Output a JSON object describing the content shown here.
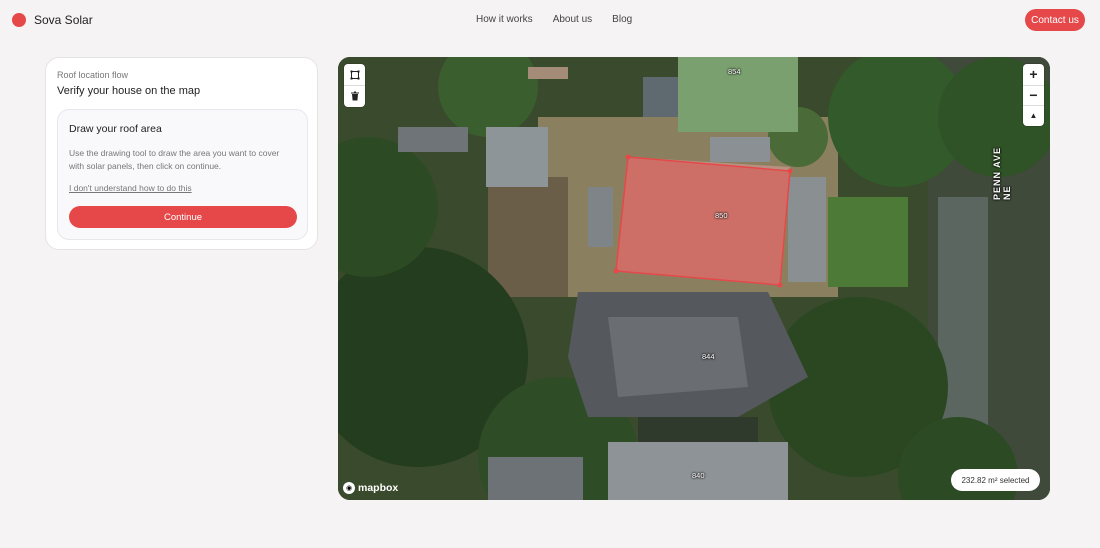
{
  "header": {
    "brand": "Sova Solar",
    "nav": [
      "How it works",
      "About us",
      "Blog"
    ],
    "contact_label": "Contact us"
  },
  "panel": {
    "flow_label": "Roof location flow",
    "title": "Verify your house on the map",
    "card": {
      "title": "Draw your roof area",
      "description": "Use the drawing tool to draw the area you want to cover with solar panels, then click on continue.",
      "help_link": "I don't understand how to do this",
      "continue_label": "Continue"
    }
  },
  "map": {
    "street": "PENN AVE NE",
    "house_numbers": [
      "854",
      "850",
      "844",
      "840"
    ],
    "attribution": "mapbox",
    "selected_area": "232.82 m² selected",
    "zoom_in": "+",
    "zoom_out": "−",
    "compass": "▲",
    "tools": [
      "draw-polygon-icon",
      "trash-icon"
    ]
  },
  "colors": {
    "accent": "#e6484a",
    "background": "#f5f3f3"
  }
}
